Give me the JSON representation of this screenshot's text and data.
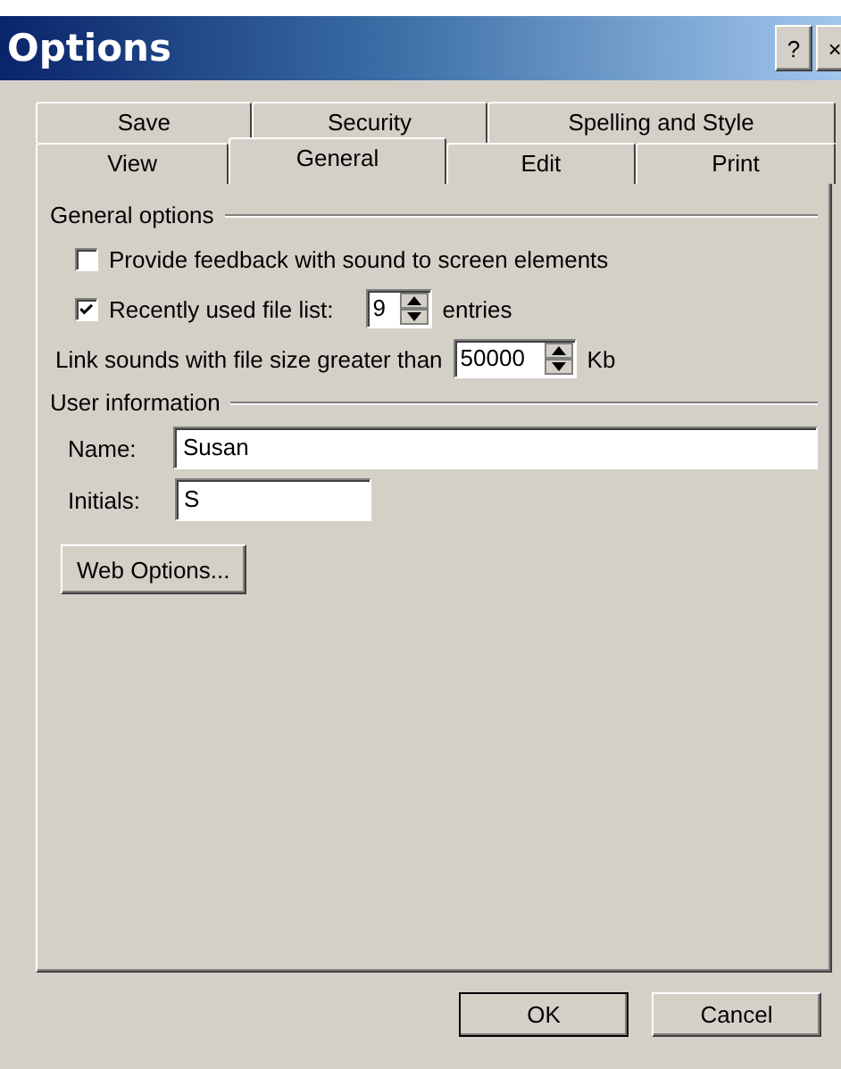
{
  "window": {
    "title": "Options",
    "title_buttons": [
      "?",
      "×"
    ]
  },
  "tab_rows": [
    [
      {
        "label": "Save",
        "selected": false
      },
      {
        "label": "Security",
        "selected": false
      },
      {
        "label": "Spelling and Style",
        "selected": false
      }
    ],
    [
      {
        "label": "View",
        "selected": false
      },
      {
        "label": "General",
        "selected": true
      },
      {
        "label": "Edit",
        "selected": false
      },
      {
        "label": "Print",
        "selected": false
      }
    ]
  ],
  "general_options": {
    "title": "General options",
    "items": [
      {
        "kind": "checkbox",
        "label": "Provide feedback with sound to screen elements",
        "checked": false
      },
      {
        "kind": "checkbox_spin",
        "label": "Recently used file list:",
        "checked": true,
        "value": "9",
        "suffix": "entries"
      },
      {
        "kind": "spin",
        "label": "Link sounds with file size greater than",
        "value": "50000",
        "suffix": "Kb"
      }
    ]
  },
  "user_information": {
    "title": "User information",
    "fields": [
      {
        "label": "Name:",
        "value": "Susan"
      },
      {
        "label": "Initials:",
        "value": "S"
      }
    ]
  },
  "web_options_button": "Web Options...",
  "buttons": [
    "OK",
    "Cancel"
  ]
}
